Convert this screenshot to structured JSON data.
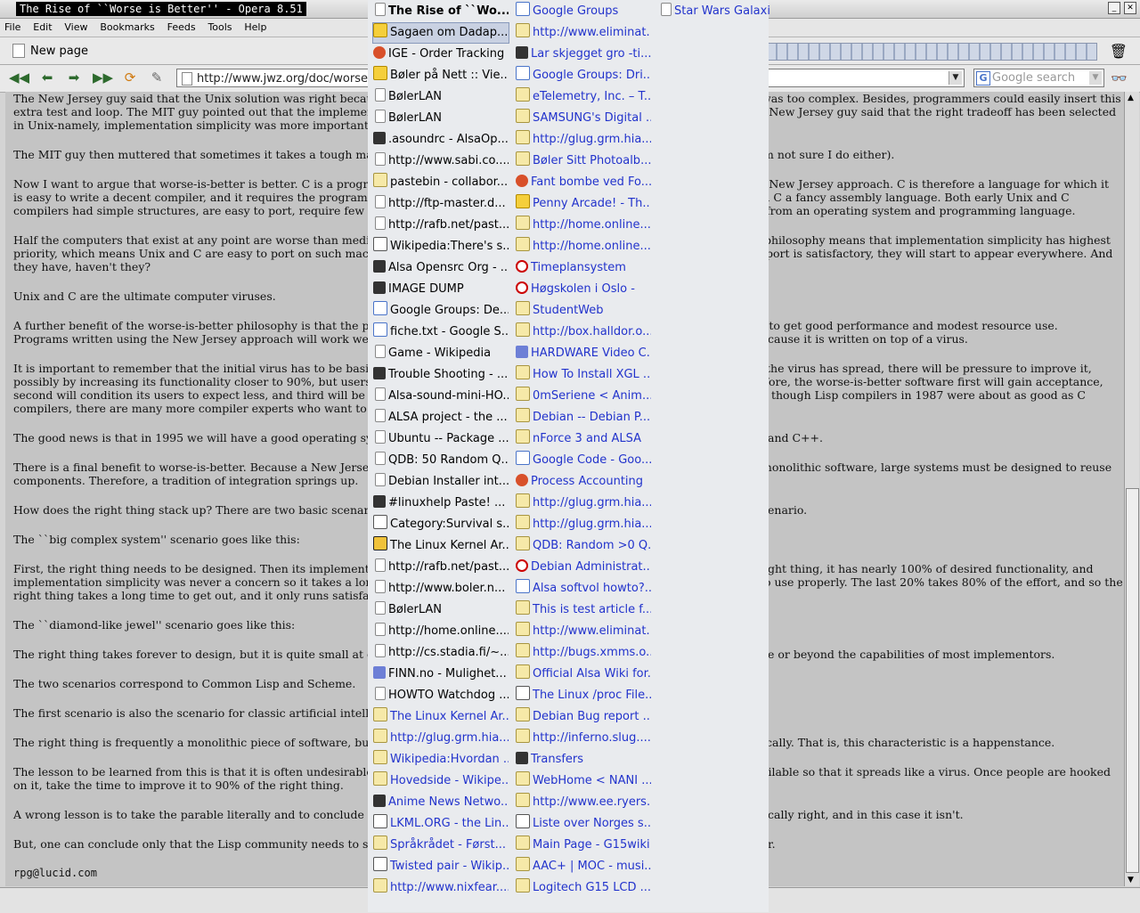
{
  "window": {
    "title": "The Rise of ``Worse is Better'' - Opera 8.51"
  },
  "menu": [
    "File",
    "Edit",
    "View",
    "Bookmarks",
    "Feeds",
    "Tools",
    "Help"
  ],
  "tab": {
    "label": "New page"
  },
  "address": {
    "url": "http://www.jwz.org/doc/worse-is"
  },
  "search": {
    "placeholder": "Google search"
  },
  "content": [
    "The New Jersey guy said that the Unix solution was right becaus",
    "extra test and loop. The MIT guy pointed out that the implement",
    "in Unix-namely, implementation simplicity was more important",
    "The MIT guy then muttered that sometimes it takes a tough man",
    "Now I want to argue that worse-is-better is better. C is a progra",
    "is easy to write a decent compiler, and it requires the programm",
    "compilers had simple structures, are easy to port, require few m",
    "Half the computers that exist at any point are worse than media",
    "priority, which means Unix and C are easy to port on such mach",
    "they have, haven't they?",
    "Unix and C are the ultimate computer viruses.",
    "A further benefit of the worse-is-better philosophy is that the pr",
    "Programs written using the New Jersey approach will work well",
    "It is important to remember that the initial virus has to be basic",
    "possibly by increasing its functionality closer to 90%, but users",
    "second will condition its users to expect less, and third will be i",
    "compilers, there are many more compiler experts who want to m",
    "The good news is that in 1995 we will have a good operating sys",
    "There is a final benefit to worse-is-better. Because a New Jersey",
    "components. Therefore, a tradition of integration springs up.",
    "How does the right thing stack up? There are two basic scenario",
    "The ``big complex system'' scenario goes like this:",
    "First, the right thing needs to be designed. Then its implementa",
    "implementation simplicity was never a concern so it takes a long",
    "right thing takes a long time to get out, and it only runs satisfac",
    "The ``diamond-like jewel'' scenario goes like this:",
    "The right thing takes forever to design, but it is quite small at e",
    "The two scenarios correspond to Common Lisp and Scheme.",
    "The first scenario is also the scenario for classic artificial intellig",
    "The right thing is frequently a monolithic piece of software, but",
    "The lesson to be learned from this is that it is often undesirable",
    "on it, take the time to improve it to 90% of the right thing.",
    "A wrong lesson is to take the parable literally and to conclude th",
    "But, one can conclude only that the Lisp community needs to se",
    "rpg@lucid.com"
  ],
  "content_right": [
    "was too complex. Besides, programmers could easily insert this",
    "e New Jersey guy said that the right tradeoff has been selected",
    "m not sure I do either).",
    "e New Jersey approach. C is therefore a language for which it",
    "lled C a fancy assembly language. Both early Unix and C",
    "from an operating system and programming language.",
    "r philosophy means that implementation simplicity has highest",
    "pport is satisfactory, they will start to appear everywhere. And",
    "ble to get good performance and modest resource use.",
    "cause it is written on top of a virus.",
    "the virus has spread, there will be pressure to improve it,",
    "refore, the worse-is-better software first will gain acceptance,",
    ". though Lisp compilers in 1987 were about as good as C",
    "and C++.",
    "monolithic software, large systems must be designed to reuse",
    "enario.",
    "ght thing, it has nearly 100% of desired functionality, and",
    "o use properly. The last 20% takes 80% of the effort, and so the",
    "e or beyond the capabilities of most implementors.",
    "ically. That is, this characteristic is a happenstance.",
    "ailable so that it spreads like a virus. Once people are hooked",
    "ically right, and in this case it isn't.",
    "r."
  ],
  "history_col1": [
    "The Rise of ``Wo...",
    "Sagaen om Dadap...",
    "IGE - Order Tracking",
    "Bøler på Nett :: Vie...",
    "BølerLAN",
    "BølerLAN",
    ".asoundrc - AlsaOp...",
    "http://www.sabi.co....",
    "pastebin - collabor...",
    "http://ftp-master.d...",
    "http://rafb.net/past...",
    "Wikipedia:There's s...",
    "Alsa Opensrc Org - ...",
    "IMAGE DUMP",
    "Google Groups: De...",
    "fiche.txt - Google S...",
    "Game - Wikipedia",
    "Trouble Shooting - ...",
    "Alsa-sound-mini-HO...",
    "ALSA project - the ...",
    "Ubuntu -- Package ...",
    "QDB: 50 Random Q...",
    "Debian Installer int...",
    "#linuxhelp Paste! ...",
    "Category:Survival s...",
    "The Linux Kernel Ar...",
    "http://rafb.net/past...",
    "http://www.boler.n...",
    "BølerLAN",
    "http://home.online....",
    "http://cs.stadia.fi/~...",
    "FINN.no - Mulighet...",
    "HOWTO Watchdog ...",
    "The Linux Kernel Ar...",
    "http://glug.grm.hia....",
    "Wikipedia:Hvordan ...",
    "Hovedside - Wikipe...",
    "Anime News Netwo...",
    "LKML.ORG - the Lin...",
    "Språkrådet - Først...",
    "Twisted pair - Wikip...",
    "http://www.nixfear...."
  ],
  "history_col2": [
    "Google Groups",
    "http://www.eliminat...",
    "Lar skjegget gro -ti...",
    "Google Groups: Dri...",
    "eTelemetry, Inc. – T...",
    "SAMSUNG's Digital ...",
    "http://glug.grm.hia....",
    "Bøler Sitt Photoalb...",
    "Fant bombe ved Fo...",
    "Penny Arcade! - Th...",
    "http://home.online....",
    "http://home.online....",
    "Timeplansystem",
    "Høgskolen i Oslo -",
    "StudentWeb",
    "http://box.halldor.o...",
    "HARDWARE Video C...",
    "How To Install XGL ...",
    "0mSeriene < Anim...",
    "Debian -- Debian P...",
    "nForce 3 and ALSA",
    "Google Code - Goo...",
    "Process Accounting",
    "http://glug.grm.hia....",
    "http://glug.grm.hia....",
    "QDB: Random >0 Q...",
    "Debian Administrat...",
    "Alsa softvol howto?...",
    "This is test article f...",
    "http://www.eliminat...",
    "http://bugs.xmms.o...",
    "Official Alsa Wiki for...",
    "The Linux /proc File...",
    "Debian Bug report ...",
    "http://inferno.slug....",
    "Transfers",
    "WebHome < NANI ...",
    "http://www.ee.ryers...",
    "Liste over Norges s...",
    "Main Page - G15wiki",
    "AAC+ | MOC - musi...",
    "Logitech G15 LCD ..."
  ],
  "history_col3": [
    "Star Wars Galaxie"
  ]
}
